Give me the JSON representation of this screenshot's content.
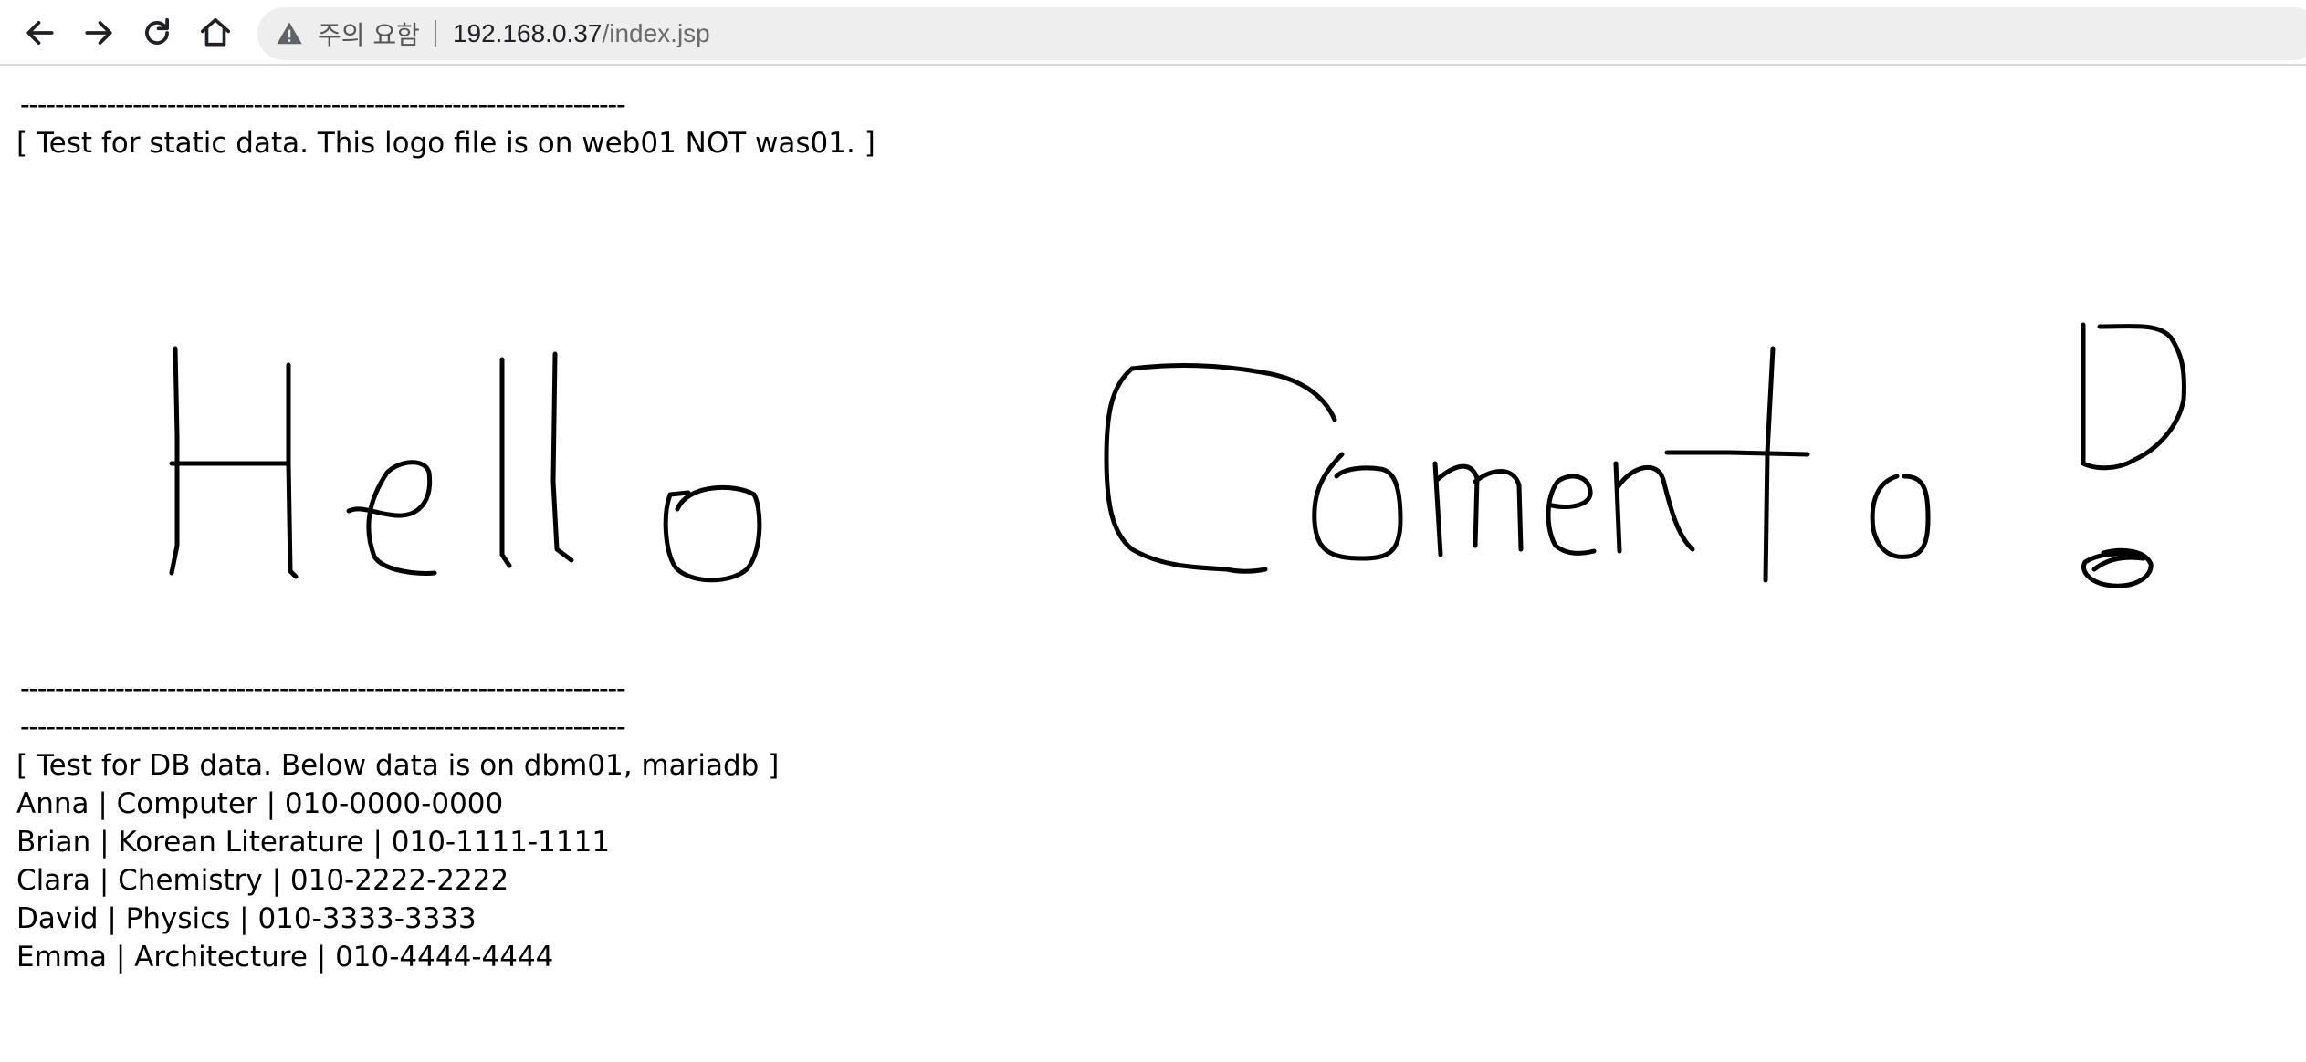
{
  "browser": {
    "back_icon": "arrow-left-icon",
    "forward_icon": "arrow-right-icon",
    "reload_icon": "reload-icon",
    "home_icon": "home-icon",
    "security_icon": "warning-triangle-icon",
    "security_label": "주의 요함",
    "url_host": "192.168.0.37",
    "url_path": "/index.jsp"
  },
  "page": {
    "separator": "----------------------------------------------------------------------",
    "static_heading": "[ Test for static data. This logo file is on web01 NOT was01. ]",
    "logo_text": "Hello Comento !",
    "db_heading": "[ Test for DB data. Below data is on dbm01, mariadb ]",
    "rows": [
      "Anna | Computer | 010-0000-0000",
      "Brian | Korean Literature | 010-1111-1111",
      "Clara | Chemistry | 010-2222-2222",
      "David | Physics | 010-3333-3333",
      "Emma | Architecture | 010-4444-4444"
    ]
  }
}
